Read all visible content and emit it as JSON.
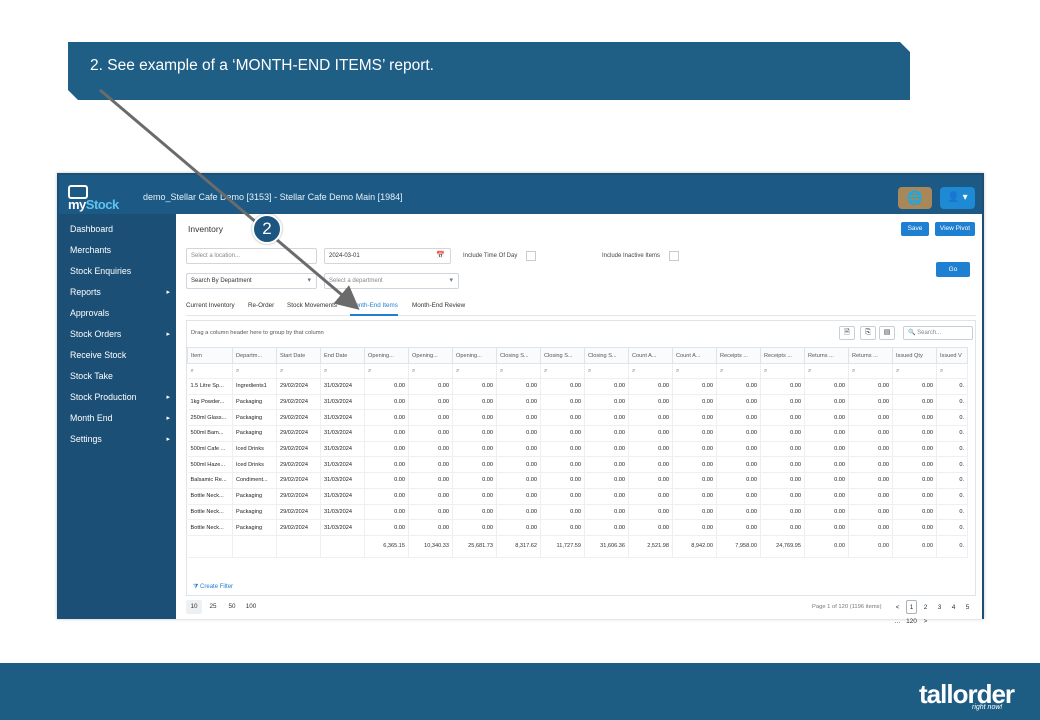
{
  "callout": {
    "text": "2. See example of a ‘MONTH-END ITEMS’ report."
  },
  "step_badge": "2",
  "app": {
    "logo": {
      "prefix": "my",
      "suffix": "Stock"
    },
    "title": "demo_Stellar Cafe Demo [3153] - Stellar Cafe Demo Main [1984]",
    "globe_icon": "🌐",
    "user_icon": "👤 ▾"
  },
  "sidebar": {
    "items": [
      {
        "label": "Dashboard",
        "has_children": false
      },
      {
        "label": "Merchants",
        "has_children": false
      },
      {
        "label": "Stock Enquiries",
        "has_children": false
      },
      {
        "label": "Reports",
        "has_children": true
      },
      {
        "label": "Approvals",
        "has_children": false
      },
      {
        "label": "Stock Orders",
        "has_children": true
      },
      {
        "label": "Receive Stock",
        "has_children": false
      },
      {
        "label": "Stock Take",
        "has_children": false
      },
      {
        "label": "Stock Production",
        "has_children": true
      },
      {
        "label": "Month End",
        "has_children": true
      },
      {
        "label": "Settings",
        "has_children": true
      }
    ],
    "arrow_glyph": "▸"
  },
  "page": {
    "title": "Inventory",
    "save_label": "Save",
    "view_pivot_label": "View Pivot",
    "go_label": "Go",
    "location_placeholder": "Select a location...",
    "date_value": "2024-03-01",
    "include_time_label": "Include Time Of Day",
    "include_inactive_label": "Include Inactive Items",
    "search_by_value": "Search By Department",
    "department_placeholder": "Select a department",
    "calendar_icon": "📅",
    "caret_icon": "▾"
  },
  "tabs": [
    {
      "label": "Current Inventory",
      "active": false
    },
    {
      "label": "Re-Order",
      "active": false
    },
    {
      "label": "Stock Movements",
      "active": false
    },
    {
      "label": "Month-End Items",
      "active": true
    },
    {
      "label": "Month-End Review",
      "active": false
    }
  ],
  "grid": {
    "group_hint": "Drag a column header here to group by that column",
    "search_placeholder": "Search...",
    "search_icon": "🔍",
    "columns": [
      "Item",
      "Departm...",
      "Start Date",
      "End Date",
      "Opening...",
      "Opening...",
      "Opening...",
      "Closing S...",
      "Closing S...",
      "Closing S...",
      "Count A...",
      "Count A...",
      "Receipts ...",
      "Receipts ...",
      "Returns ...",
      "Returns ...",
      "Issued Qty",
      "Issued V"
    ],
    "rows": [
      [
        "1.5 Litre Sp...",
        "Ingredients1",
        "29/02/2024",
        "31/03/2024",
        "0.00",
        "0.00",
        "0.00",
        "0.00",
        "0.00",
        "0.00",
        "0.00",
        "0.00",
        "0.00",
        "0.00",
        "0.00",
        "0.00",
        "0.00",
        "0."
      ],
      [
        "1kg Powder...",
        "Packaging",
        "29/02/2024",
        "31/03/2024",
        "0.00",
        "0.00",
        "0.00",
        "0.00",
        "0.00",
        "0.00",
        "0.00",
        "0.00",
        "0.00",
        "0.00",
        "0.00",
        "0.00",
        "0.00",
        "0."
      ],
      [
        "250ml Glass...",
        "Packaging",
        "29/02/2024",
        "31/03/2024",
        "0.00",
        "0.00",
        "0.00",
        "0.00",
        "0.00",
        "0.00",
        "0.00",
        "0.00",
        "0.00",
        "0.00",
        "0.00",
        "0.00",
        "0.00",
        "0."
      ],
      [
        "500ml Bam...",
        "Packaging",
        "29/02/2024",
        "31/03/2024",
        "0.00",
        "0.00",
        "0.00",
        "0.00",
        "0.00",
        "0.00",
        "0.00",
        "0.00",
        "0.00",
        "0.00",
        "0.00",
        "0.00",
        "0.00",
        "0."
      ],
      [
        "500ml Cafe ...",
        "Iced Drinks",
        "29/02/2024",
        "31/03/2024",
        "0.00",
        "0.00",
        "0.00",
        "0.00",
        "0.00",
        "0.00",
        "0.00",
        "0.00",
        "0.00",
        "0.00",
        "0.00",
        "0.00",
        "0.00",
        "0."
      ],
      [
        "500ml Haze...",
        "Iced Drinks",
        "29/02/2024",
        "31/03/2024",
        "0.00",
        "0.00",
        "0.00",
        "0.00",
        "0.00",
        "0.00",
        "0.00",
        "0.00",
        "0.00",
        "0.00",
        "0.00",
        "0.00",
        "0.00",
        "0."
      ],
      [
        "Balsamic Re...",
        "Condiment...",
        "29/02/2024",
        "31/03/2024",
        "0.00",
        "0.00",
        "0.00",
        "0.00",
        "0.00",
        "0.00",
        "0.00",
        "0.00",
        "0.00",
        "0.00",
        "0.00",
        "0.00",
        "0.00",
        "0."
      ],
      [
        "Bottle Neck...",
        "Packaging",
        "29/02/2024",
        "31/03/2024",
        "0.00",
        "0.00",
        "0.00",
        "0.00",
        "0.00",
        "0.00",
        "0.00",
        "0.00",
        "0.00",
        "0.00",
        "0.00",
        "0.00",
        "0.00",
        "0."
      ],
      [
        "Bottle Neck...",
        "Packaging",
        "29/02/2024",
        "31/03/2024",
        "0.00",
        "0.00",
        "0.00",
        "0.00",
        "0.00",
        "0.00",
        "0.00",
        "0.00",
        "0.00",
        "0.00",
        "0.00",
        "0.00",
        "0.00",
        "0."
      ],
      [
        "Bottle Neck...",
        "Packaging",
        "29/02/2024",
        "31/03/2024",
        "0.00",
        "0.00",
        "0.00",
        "0.00",
        "0.00",
        "0.00",
        "0.00",
        "0.00",
        "0.00",
        "0.00",
        "0.00",
        "0.00",
        "0.00",
        "0."
      ]
    ],
    "totals": [
      "",
      "",
      "",
      "",
      "6,365.15",
      "10,340.33",
      "25,681.73",
      "8,317.62",
      "11,727.59",
      "31,606.36",
      "2,521.98",
      "8,942.00",
      "7,958.00",
      "24,769.95",
      "0.00",
      "0.00",
      "0.00",
      "0."
    ],
    "create_filter_label": "Create Filter",
    "filter_icon": "⧩"
  },
  "pager": {
    "page_sizes": [
      "10",
      "25",
      "50",
      "100"
    ],
    "selected_size": "10",
    "info": "Page 1 of 120 (1196 items)",
    "prev_glyph": "<",
    "next_glyph": ">",
    "pages": [
      "1",
      "2",
      "3",
      "4",
      "5",
      "...",
      "120"
    ],
    "current_page": "1"
  },
  "footer": {
    "brand": "tallorder",
    "tagline": "right now!"
  },
  "colors": {
    "header_blue": "#1f5f86",
    "sidebar_blue": "#1c4f76",
    "accent_blue": "#1f7fd0",
    "globe_gold": "#a8875a"
  }
}
